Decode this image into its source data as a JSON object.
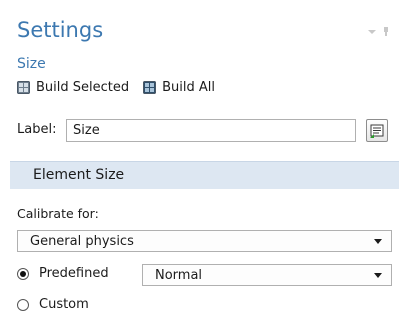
{
  "header": {
    "title": "Settings",
    "dropdown_icon": "chevron-down-icon",
    "pin_icon": "pin-icon"
  },
  "node": {
    "name": "Size",
    "build_selected_label": "Build Selected",
    "build_all_label": "Build All"
  },
  "label_field": {
    "caption": "Label:",
    "value": "Size"
  },
  "section": {
    "title": "Element Size"
  },
  "calibrate": {
    "caption": "Calibrate for:",
    "selected": "General physics"
  },
  "size_mode": {
    "predefined_label": "Predefined",
    "predefined_value": "Normal",
    "custom_label": "Custom",
    "selected": "Predefined"
  },
  "colors": {
    "accent": "#3c78b0",
    "section_bg": "#dde7f2"
  }
}
